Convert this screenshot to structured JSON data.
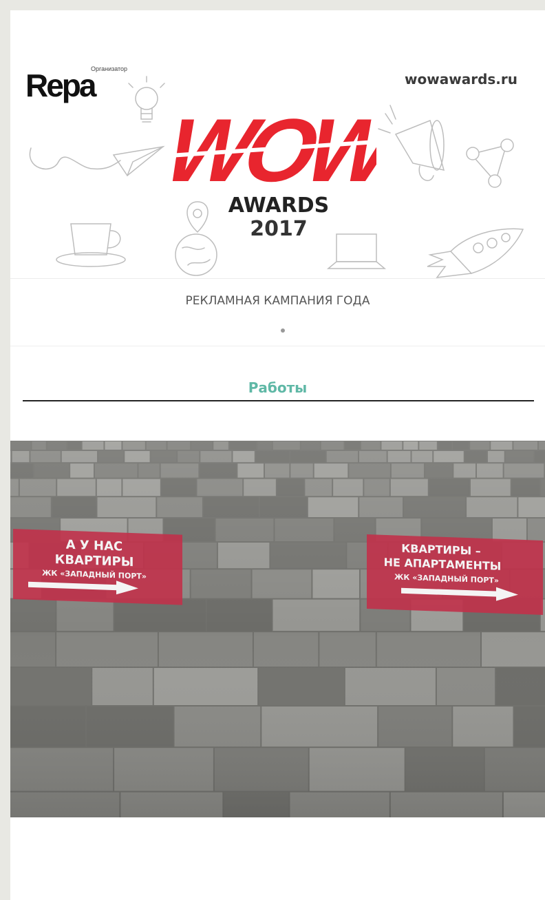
{
  "banner": {
    "organizer_label": "Организатор",
    "organizer_logo_text": "Repa",
    "site_url": "wowawards.ru",
    "wow_logo_text": "WOW",
    "awards_label": "AWARDS",
    "year": "2017",
    "wow_color": "#e8252e"
  },
  "nomination": {
    "title": "РЕКЛАМНАЯ КАМПАНИЯ ГОДА"
  },
  "tabs": {
    "works_label": "Работы",
    "accent_color": "#5fb8a6"
  },
  "photo": {
    "sign_left": {
      "line1": "А У НАС",
      "line2": "КВАРТИРЫ",
      "line3": "ЖК «ЗАПАДНЫЙ ПОРТ»"
    },
    "sign_right": {
      "line1": "КВАРТИРЫ –",
      "line2": "НЕ АПАРТАМЕНТЫ",
      "line3": "ЖК «ЗАПАДНЫЙ ПОРТ»"
    },
    "sign_color": "#c1314a"
  }
}
